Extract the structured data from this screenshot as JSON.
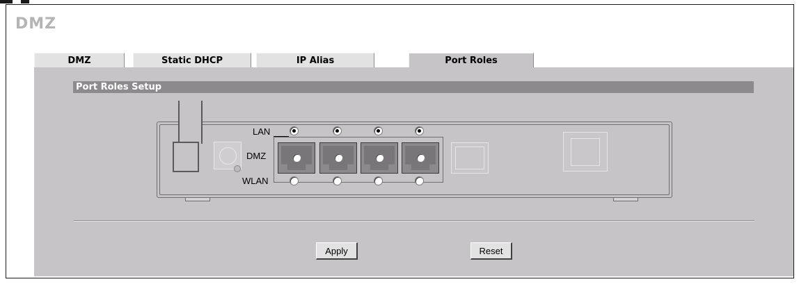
{
  "page": {
    "title": "DMZ"
  },
  "tabs": [
    {
      "label": "DMZ",
      "active": false
    },
    {
      "label": "Static DHCP",
      "active": false
    },
    {
      "label": "IP Alias",
      "active": false
    },
    {
      "label": "Port Roles",
      "active": true
    }
  ],
  "section": {
    "title": "Port Roles Setup"
  },
  "roles": {
    "lan_label": "LAN",
    "dmz_label": "DMZ",
    "wlan_label": "WLAN"
  },
  "ports": [
    {
      "port": 1,
      "selected_role": "LAN"
    },
    {
      "port": 2,
      "selected_role": "LAN"
    },
    {
      "port": 3,
      "selected_role": "LAN"
    },
    {
      "port": 4,
      "selected_role": "LAN"
    }
  ],
  "buttons": {
    "apply_label": "Apply",
    "reset_label": "Reset"
  },
  "colors": {
    "panel_bg": "#c7c4c7",
    "section_header_bg": "#8c8a8c",
    "tab_bg": "#e2e2e2",
    "title_color": "#b4b4b4"
  }
}
